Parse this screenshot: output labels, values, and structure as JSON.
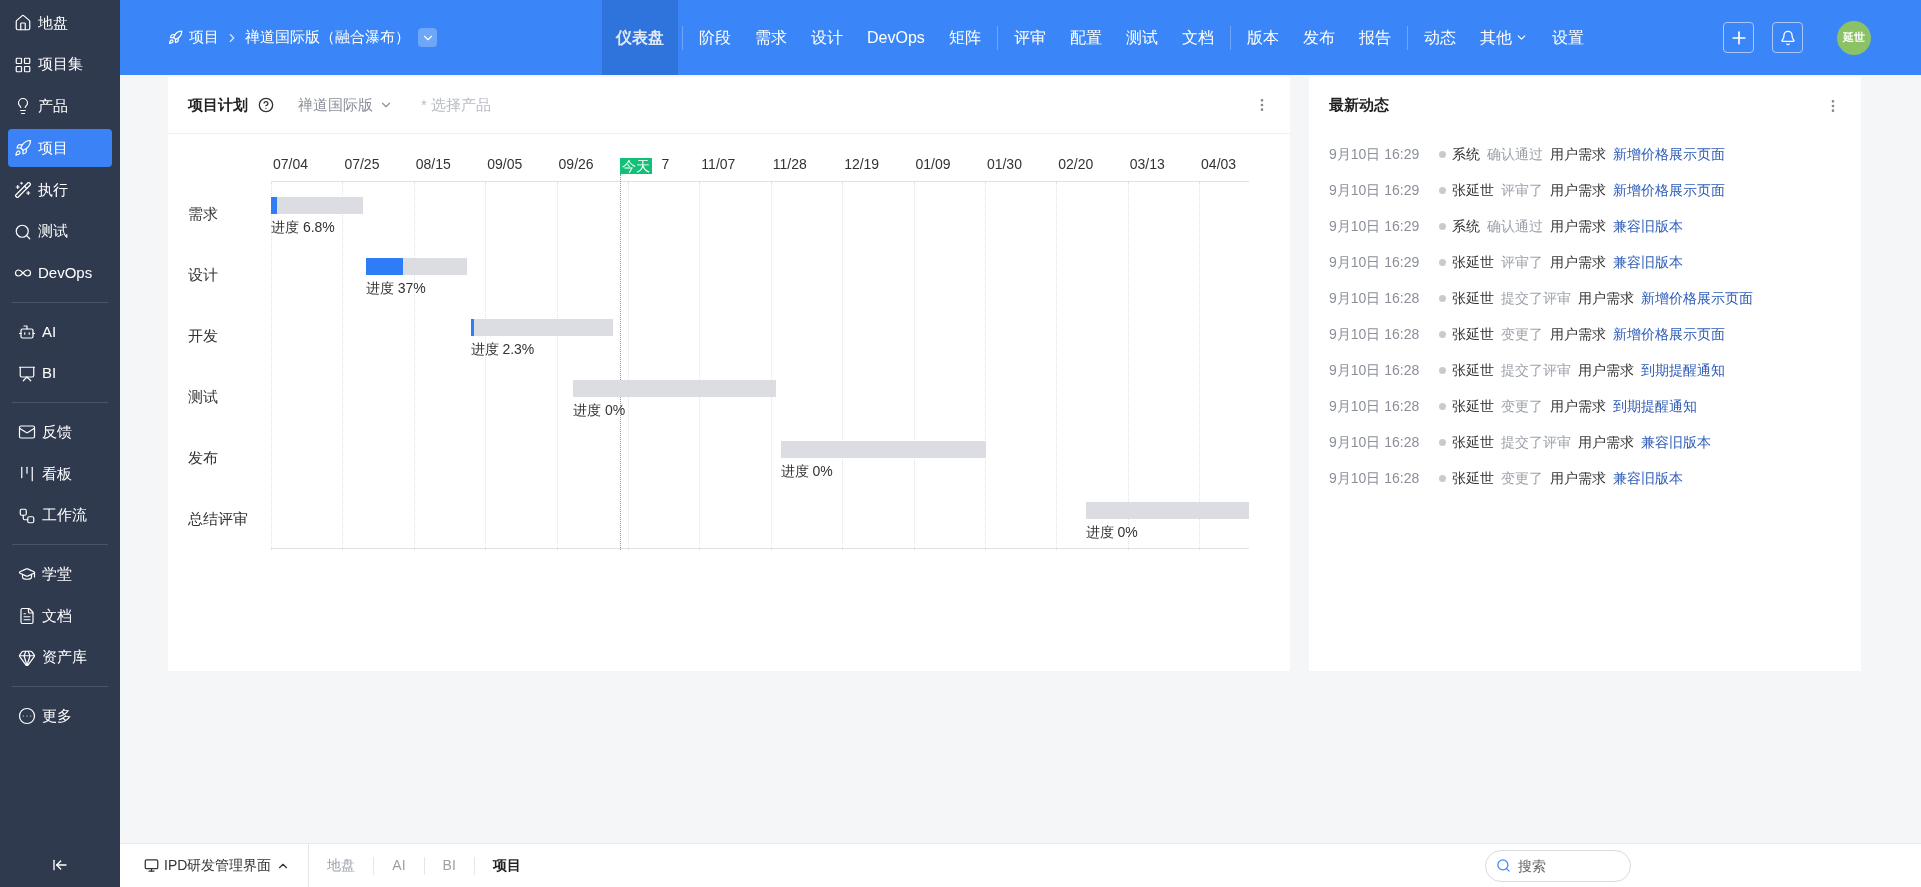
{
  "sidebar": {
    "groups": [
      [
        {
          "label": "地盘",
          "selected": false
        },
        {
          "label": "项目集",
          "selected": false
        },
        {
          "label": "产品",
          "selected": false
        },
        {
          "label": "项目",
          "selected": true
        },
        {
          "label": "执行",
          "selected": false
        },
        {
          "label": "测试",
          "selected": false
        },
        {
          "label": "DevOps",
          "selected": false
        }
      ],
      [
        {
          "label": "AI",
          "selected": false
        },
        {
          "label": "BI",
          "selected": false
        }
      ],
      [
        {
          "label": "反馈",
          "selected": false
        },
        {
          "label": "看板",
          "selected": false
        },
        {
          "label": "工作流",
          "selected": false
        }
      ],
      [
        {
          "label": "学堂",
          "selected": false
        },
        {
          "label": "文档",
          "selected": false
        },
        {
          "label": "资产库",
          "selected": false
        }
      ],
      [
        {
          "label": "更多",
          "selected": false
        }
      ]
    ]
  },
  "topbar": {
    "breadcrumb": [
      "项目",
      "禅道国际版（融合瀑布）"
    ],
    "nav_groups": [
      [
        {
          "label": "仪表盘",
          "selected": true
        }
      ],
      [
        {
          "label": "阶段",
          "selected": false
        },
        {
          "label": "需求",
          "selected": false
        },
        {
          "label": "设计",
          "selected": false
        },
        {
          "label": "DevOps",
          "selected": false
        },
        {
          "label": "矩阵",
          "selected": false
        }
      ],
      [
        {
          "label": "评审",
          "selected": false
        },
        {
          "label": "配置",
          "selected": false
        },
        {
          "label": "测试",
          "selected": false
        },
        {
          "label": "文档",
          "selected": false
        }
      ],
      [
        {
          "label": "版本",
          "selected": false
        },
        {
          "label": "发布",
          "selected": false
        },
        {
          "label": "报告",
          "selected": false
        }
      ],
      [
        {
          "label": "动态",
          "selected": false
        },
        {
          "label": "其他",
          "selected": false,
          "dropdown": true
        },
        {
          "label": "设置",
          "selected": false
        }
      ]
    ],
    "avatar": "延世"
  },
  "plan": {
    "title": "项目计划",
    "product": "禅道国际版",
    "product_placeholder": "* 选择产品",
    "ticks": [
      "07/04",
      "07/25",
      "08/15",
      "09/05",
      "09/26",
      "7",
      "11/07",
      "11/28",
      "12/19",
      "01/09",
      "01/30",
      "02/20",
      "03/13",
      "04/03"
    ],
    "today": "今天",
    "phases": [
      {
        "name": "需求",
        "progress": "进度 6.8%",
        "level": 0.068
      },
      {
        "name": "设计",
        "progress": "进度 37%",
        "level": 0.37
      },
      {
        "name": "开发",
        "progress": "进度 2.3%",
        "level": 0.023
      },
      {
        "name": "测试",
        "progress": "进度 0%",
        "level": 0
      },
      {
        "name": "发布",
        "progress": "进度 0%",
        "level": 0
      },
      {
        "name": "总结评审",
        "progress": "进度 0%",
        "level": 0
      }
    ]
  },
  "activity": {
    "title": "最新动态",
    "items": [
      {
        "time": "9月10日 16:29",
        "actor": "系统",
        "action": "确认通过",
        "type": "用户需求",
        "target": "新增价格展示页面"
      },
      {
        "time": "9月10日 16:29",
        "actor": "张延世",
        "action": "评审了",
        "type": "用户需求",
        "target": "新增价格展示页面"
      },
      {
        "time": "9月10日 16:29",
        "actor": "系统",
        "action": "确认通过",
        "type": "用户需求",
        "target": "兼容旧版本"
      },
      {
        "time": "9月10日 16:29",
        "actor": "张延世",
        "action": "评审了",
        "type": "用户需求",
        "target": "兼容旧版本"
      },
      {
        "time": "9月10日 16:28",
        "actor": "张延世",
        "action": "提交了评审",
        "type": "用户需求",
        "target": "新增价格展示页面"
      },
      {
        "time": "9月10日 16:28",
        "actor": "张延世",
        "action": "变更了",
        "type": "用户需求",
        "target": "新增价格展示页面"
      },
      {
        "time": "9月10日 16:28",
        "actor": "张延世",
        "action": "提交了评审",
        "type": "用户需求",
        "target": "到期提醒通知"
      },
      {
        "time": "9月10日 16:28",
        "actor": "张延世",
        "action": "变更了",
        "type": "用户需求",
        "target": "到期提醒通知"
      },
      {
        "time": "9月10日 16:28",
        "actor": "张延世",
        "action": "提交了评审",
        "type": "用户需求",
        "target": "兼容旧版本"
      },
      {
        "time": "9月10日 16:28",
        "actor": "张延世",
        "action": "变更了",
        "type": "用户需求",
        "target": "兼容旧版本"
      }
    ]
  },
  "bottombar": {
    "app": "IPD研发管理界面",
    "tabs": [
      {
        "label": "地盘",
        "selected": false
      },
      {
        "label": "AI",
        "selected": false
      },
      {
        "label": "BI",
        "selected": false
      },
      {
        "label": "项目",
        "selected": true
      }
    ],
    "search": {
      "placeholder": "搜索"
    }
  }
}
